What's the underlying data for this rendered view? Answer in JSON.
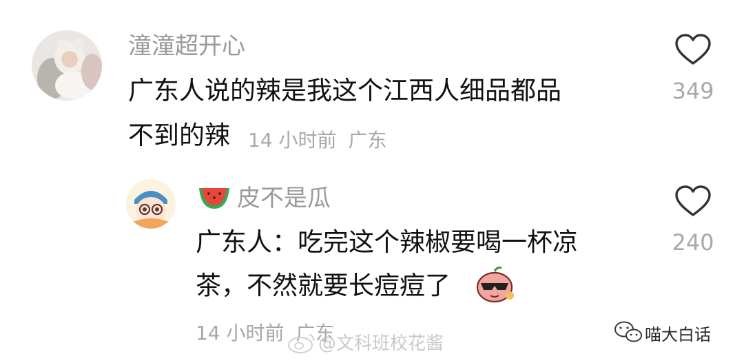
{
  "comment": {
    "username": "潼潼超开心",
    "text_line1": "广东人说的辣是我这个江西人细品都品",
    "text_line2": "不到的辣",
    "time": "14 小时前",
    "location": "广东",
    "like_count": "349",
    "avatar_icon": "baby-photo-avatar"
  },
  "reply": {
    "username_emoji_icon": "watermelon-icon",
    "username": "皮不是瓜",
    "text_line1": "广东人：吃完这个辣椒要喝一杯凉",
    "text_line2": "茶，不然就要长痘痘了",
    "sticker_icon": "cool-sunglasses-peach-sticker",
    "time": "14 小时前",
    "location": "广东",
    "like_count": "240",
    "avatar_icon": "cartoon-girl-avatar"
  },
  "watermarks": {
    "weibo": "@文科班校花酱",
    "wechat": "喵大白话"
  },
  "colors": {
    "username": "#9a9a9a",
    "body": "#111111",
    "meta": "#a8a8a8"
  }
}
